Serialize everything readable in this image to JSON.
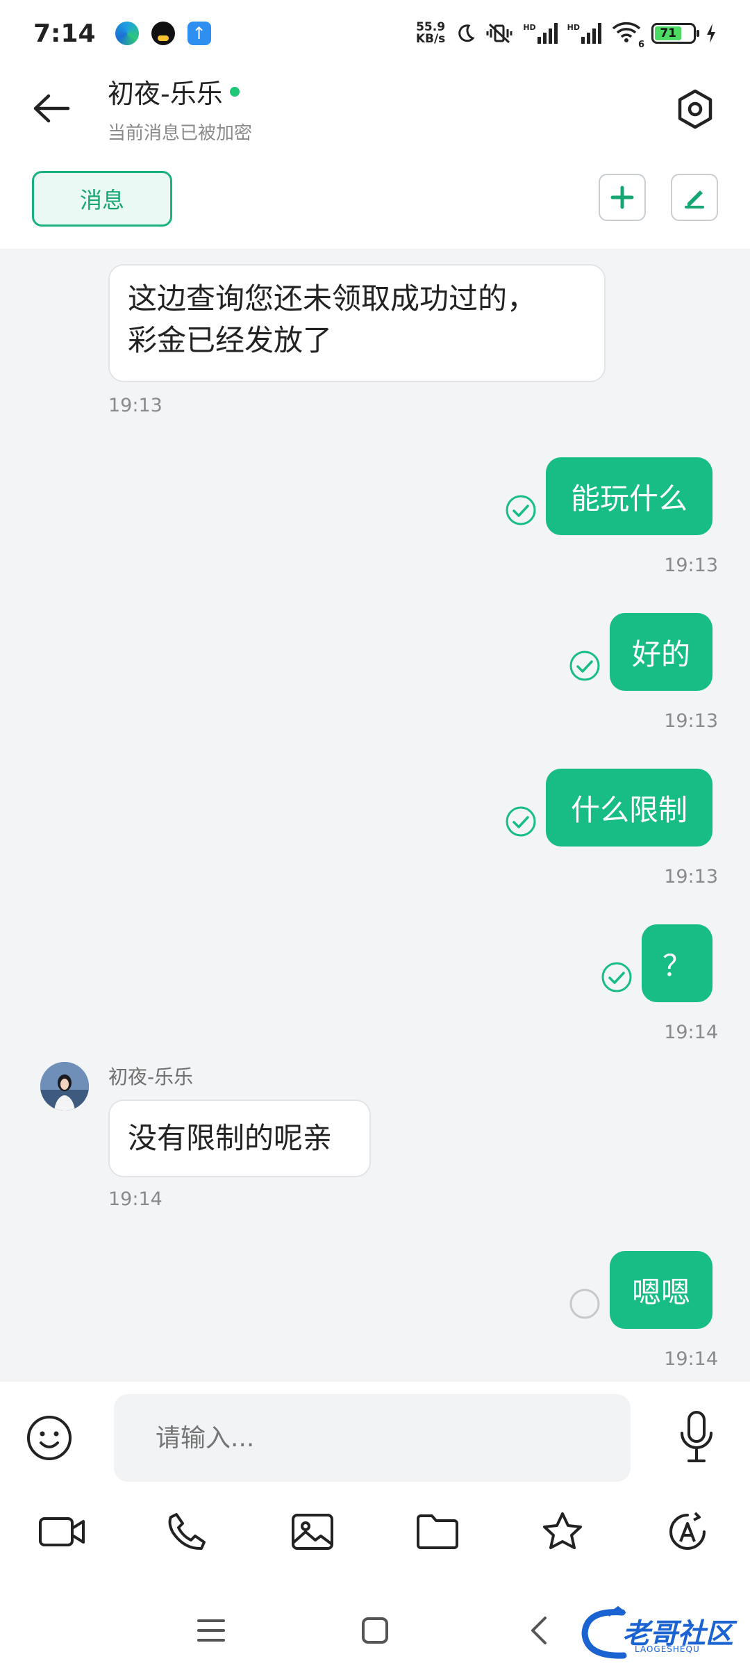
{
  "status_bar": {
    "time": "7:14",
    "net_speed_top": "55.9",
    "net_speed_unit": "KB/s",
    "hd1": "HD",
    "hd2": "HD",
    "wifi_badge": "6",
    "battery_percent": "71"
  },
  "header": {
    "contact_name": "初夜-乐乐",
    "subtitle": "当前消息已被加密",
    "online": true
  },
  "tabs": {
    "messages_label": "消息"
  },
  "messages": [
    {
      "direction": "in",
      "text_line1": "这边查询您还未领取成功过的，",
      "text_line2": "彩金已经发放了",
      "time": "19:13"
    },
    {
      "direction": "out",
      "text": "能玩什么",
      "time": "19:13",
      "status": "read"
    },
    {
      "direction": "out",
      "text": "好的",
      "time": "19:13",
      "status": "read"
    },
    {
      "direction": "out",
      "text": "什么限制",
      "time": "19:13",
      "status": "read"
    },
    {
      "direction": "out",
      "text": "？",
      "time": "19:14",
      "status": "read"
    },
    {
      "direction": "in",
      "sender": "初夜-乐乐",
      "text": "没有限制的呢亲",
      "time": "19:14"
    },
    {
      "direction": "out",
      "text": "嗯嗯",
      "time": "19:14",
      "status": "sending"
    }
  ],
  "composer": {
    "placeholder": "请输入..."
  },
  "watermark": {
    "text": "老哥社区",
    "subtext": "LAOGESHEQU"
  },
  "colors": {
    "accent": "#18bd85",
    "online": "#1ec677",
    "watermark": "#1a63d1"
  }
}
